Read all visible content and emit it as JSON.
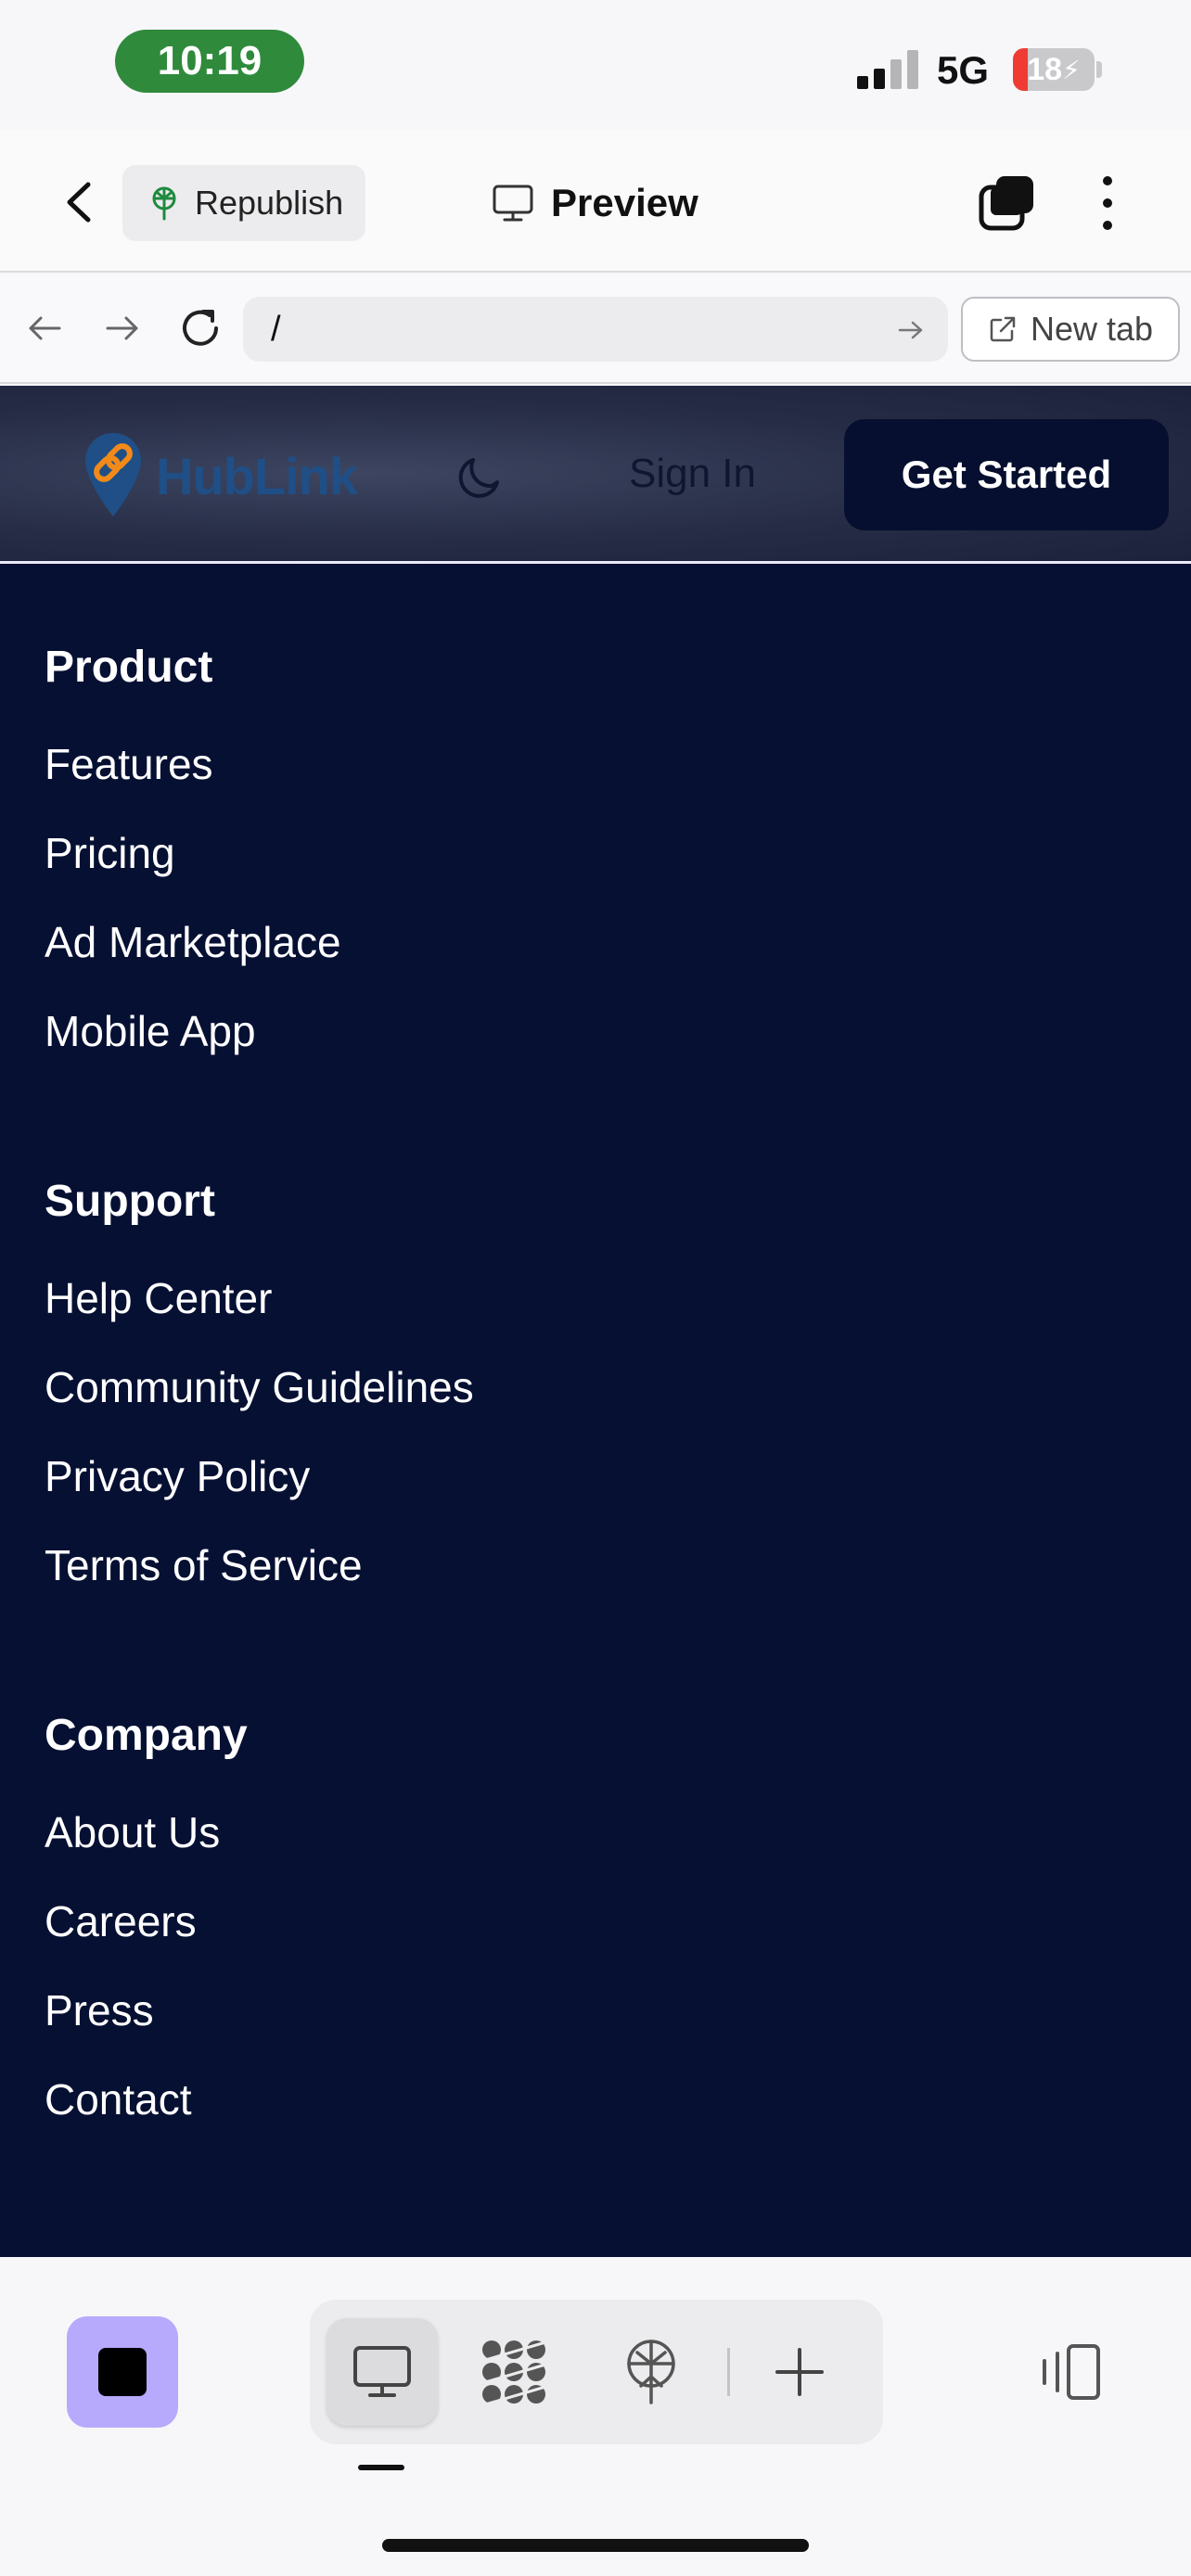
{
  "status_bar": {
    "time": "10:19",
    "network": "5G",
    "battery_level": "18",
    "battery_fill_percent": 18,
    "signal_bars_active": 2
  },
  "toolbar": {
    "republish_label": "Republish",
    "preview_label": "Preview"
  },
  "urlbar": {
    "url": "/",
    "new_tab_label": "New tab"
  },
  "site_header": {
    "logo_text": "HubLink",
    "sign_in_label": "Sign In",
    "get_started_label": "Get Started",
    "colors": {
      "logo_text": "#1f4f86",
      "logo_pin": "#f28a1a",
      "button_bg": "#060f2f"
    }
  },
  "footer": {
    "background": "#061033",
    "sections": [
      {
        "title": "Product",
        "links": [
          "Features",
          "Pricing",
          "Ad Marketplace",
          "Mobile App"
        ]
      },
      {
        "title": "Support",
        "links": [
          "Help Center",
          "Community Guidelines",
          "Privacy Policy",
          "Terms of Service"
        ]
      },
      {
        "title": "Company",
        "links": [
          "About Us",
          "Careers",
          "Press",
          "Contact"
        ]
      }
    ]
  },
  "bottom_bar": {
    "items": [
      "desktop-icon",
      "apps-icon",
      "deploy-icon",
      "plus-icon"
    ],
    "active_item": "desktop-icon",
    "stop_button_color": "#b7a9fb"
  }
}
